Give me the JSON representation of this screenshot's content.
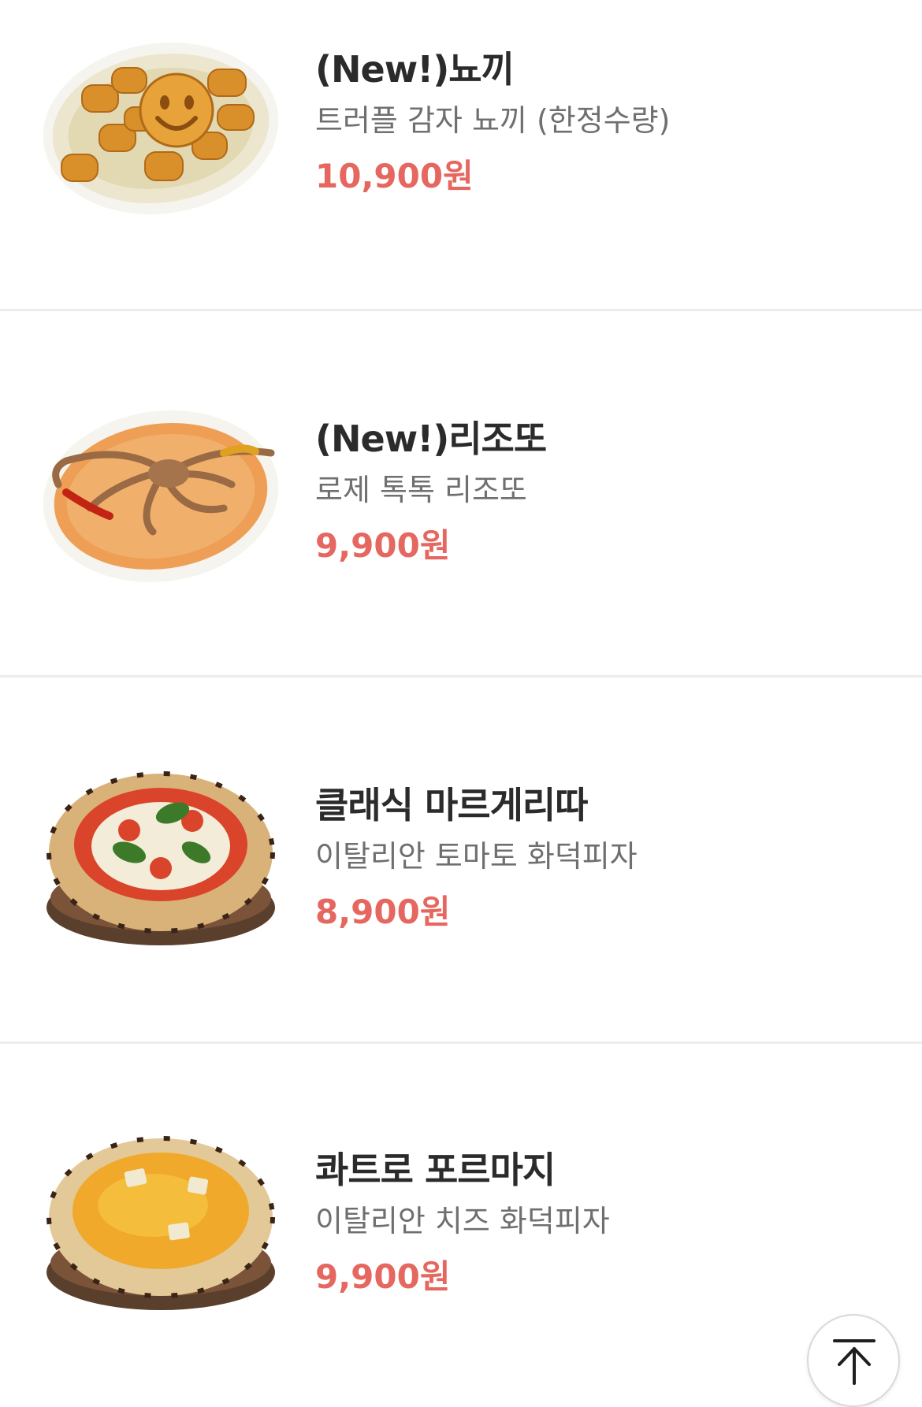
{
  "menu": {
    "items": [
      {
        "name": "(New!)뇨끼",
        "description": "트러플 감자 뇨끼 (한정수량)",
        "price": "10,900원",
        "image_icon": "gnocchi-dish-image"
      },
      {
        "name": "(New!)리조또",
        "description": "로제 톡톡 리조또",
        "price": "9,900원",
        "image_icon": "risotto-dish-image"
      },
      {
        "name": "클래식 마르게리따",
        "description": "이탈리안 토마토 화덕피자",
        "price": "8,900원",
        "image_icon": "margherita-pizza-image"
      },
      {
        "name": "콰트로 포르마지",
        "description": "이탈리안 치즈 화덕피자",
        "price": "9,900원",
        "image_icon": "quattro-formaggi-pizza-image"
      }
    ]
  },
  "colors": {
    "price": "#e5675f",
    "name": "#2b2b2b",
    "description": "#6f6f6f",
    "divider": "#ececec"
  },
  "scroll_top_button": {
    "icon": "arrow-up-to-top-icon"
  }
}
